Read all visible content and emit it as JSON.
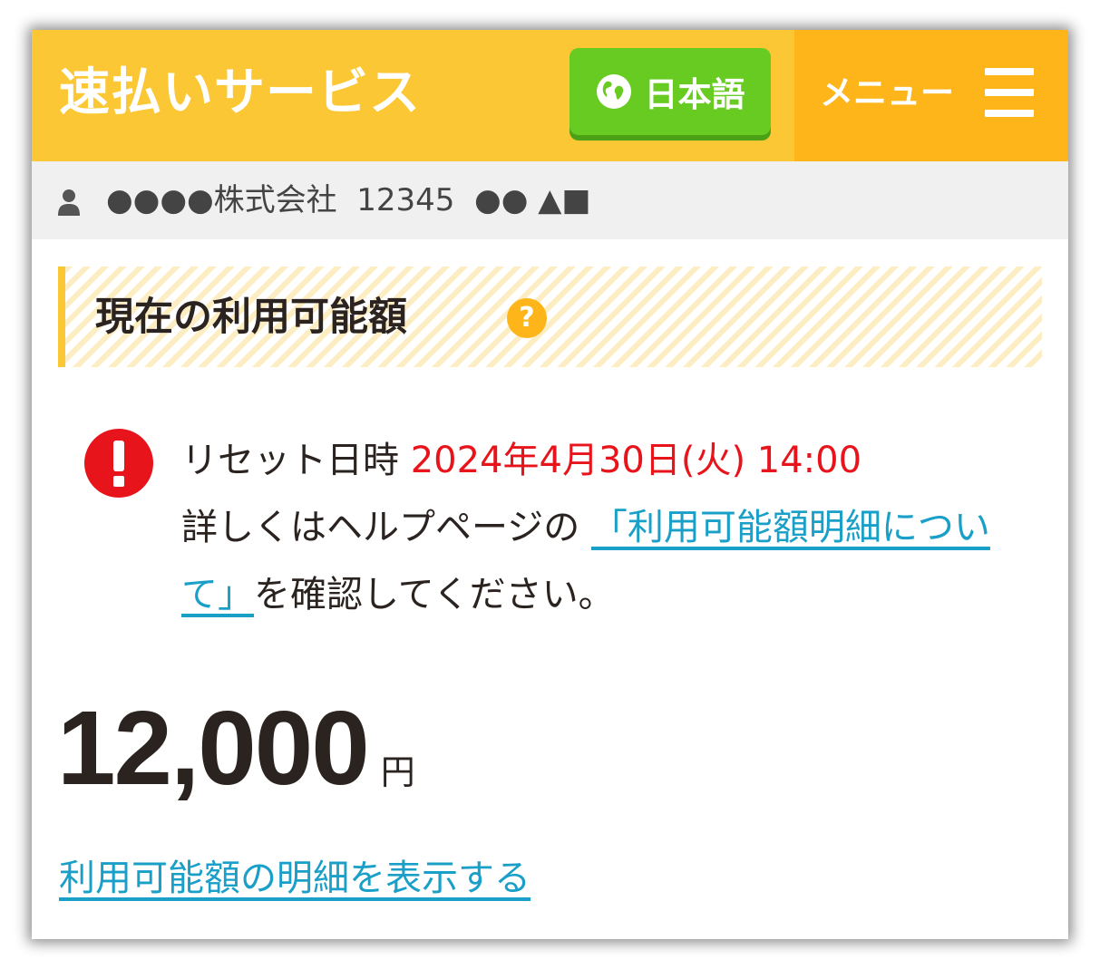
{
  "header": {
    "brand": "速払いサービス",
    "language_button": "日本語",
    "menu_label": "メニュー"
  },
  "user": {
    "info": "●●●●株式会社  12345  ●● ▲■"
  },
  "section": {
    "title": "現在の利用可能額",
    "help_icon": "?"
  },
  "alert": {
    "reset_label": "リセット日時 ",
    "reset_datetime": "2024年4月30日(火) 14:00",
    "detail_prefix": "詳しくはヘルプページの ",
    "help_link": "「利用可能額明細について」",
    "detail_suffix": "を確認してください。"
  },
  "balance": {
    "amount": "12,000",
    "unit": "円"
  },
  "links": {
    "show_details": "利用可能額の明細を表示する"
  },
  "colors": {
    "header_yellow": "#fcc734",
    "menu_orange": "#fdb519",
    "language_green": "#67cb22",
    "alert_red": "#e8141c",
    "link_blue": "#1aa0c8"
  }
}
